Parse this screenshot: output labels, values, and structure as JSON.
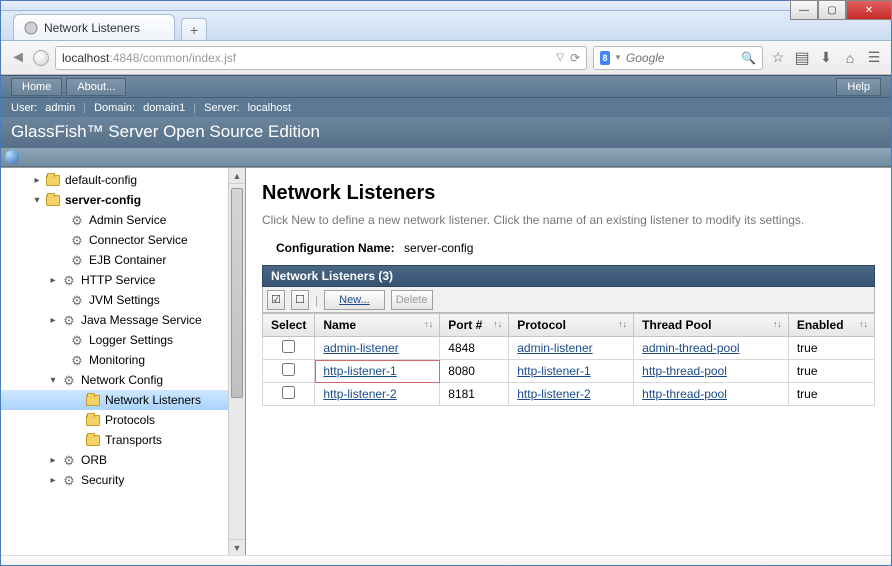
{
  "browser": {
    "tab_title": "Network Listeners",
    "url_host": "localhost",
    "url_port_path": ":4848/common/index.jsf",
    "search_placeholder": "Google"
  },
  "glassfish": {
    "menu": {
      "home": "Home",
      "about": "About...",
      "help": "Help"
    },
    "info": {
      "user_lbl": "User:",
      "user": "admin",
      "domain_lbl": "Domain:",
      "domain": "domain1",
      "server_lbl": "Server:",
      "server": "localhost"
    },
    "product_title": "GlassFish™ Server Open Source Edition"
  },
  "tree": [
    {
      "indent": 30,
      "tw": "▸",
      "icon": "folder",
      "label": "default-config",
      "bold": false
    },
    {
      "indent": 30,
      "tw": "▾",
      "icon": "folder",
      "label": "server-config",
      "bold": true
    },
    {
      "indent": 54,
      "tw": "",
      "icon": "cog",
      "label": "Admin Service"
    },
    {
      "indent": 54,
      "tw": "",
      "icon": "cog",
      "label": "Connector Service"
    },
    {
      "indent": 54,
      "tw": "",
      "icon": "cog",
      "label": "EJB Container"
    },
    {
      "indent": 46,
      "tw": "▸",
      "icon": "cog",
      "label": "HTTP Service"
    },
    {
      "indent": 54,
      "tw": "",
      "icon": "cog",
      "label": "JVM Settings"
    },
    {
      "indent": 46,
      "tw": "▸",
      "icon": "cog",
      "label": "Java Message Service"
    },
    {
      "indent": 54,
      "tw": "",
      "icon": "cog",
      "label": "Logger Settings"
    },
    {
      "indent": 54,
      "tw": "",
      "icon": "cog",
      "label": "Monitoring"
    },
    {
      "indent": 46,
      "tw": "▾",
      "icon": "cog",
      "label": "Network Config"
    },
    {
      "indent": 70,
      "tw": "",
      "icon": "folder",
      "label": "Network Listeners",
      "selected": true
    },
    {
      "indent": 70,
      "tw": "",
      "icon": "folder",
      "label": "Protocols"
    },
    {
      "indent": 70,
      "tw": "",
      "icon": "folder",
      "label": "Transports"
    },
    {
      "indent": 46,
      "tw": "▸",
      "icon": "cog",
      "label": "ORB"
    },
    {
      "indent": 46,
      "tw": "▸",
      "icon": "cog",
      "label": "Security"
    }
  ],
  "page": {
    "title": "Network Listeners",
    "desc": "Click New to define a new network listener. Click the name of an existing listener to modify its settings.",
    "config_label": "Configuration Name:",
    "config_value": "server-config",
    "table_title": "Network Listeners (3)",
    "buttons": {
      "new": "New...",
      "delete": "Delete"
    },
    "columns": {
      "select": "Select",
      "name": "Name",
      "port": "Port #",
      "protocol": "Protocol",
      "pool": "Thread Pool",
      "enabled": "Enabled"
    },
    "rows": [
      {
        "name": "admin-listener",
        "port": "4848",
        "protocol": "admin-listener",
        "pool": "admin-thread-pool",
        "enabled": "true",
        "hl": false
      },
      {
        "name": "http-listener-1",
        "port": "8080",
        "protocol": "http-listener-1",
        "pool": "http-thread-pool",
        "enabled": "true",
        "hl": true
      },
      {
        "name": "http-listener-2",
        "port": "8181",
        "protocol": "http-listener-2",
        "pool": "http-thread-pool",
        "enabled": "true",
        "hl": false
      }
    ]
  }
}
